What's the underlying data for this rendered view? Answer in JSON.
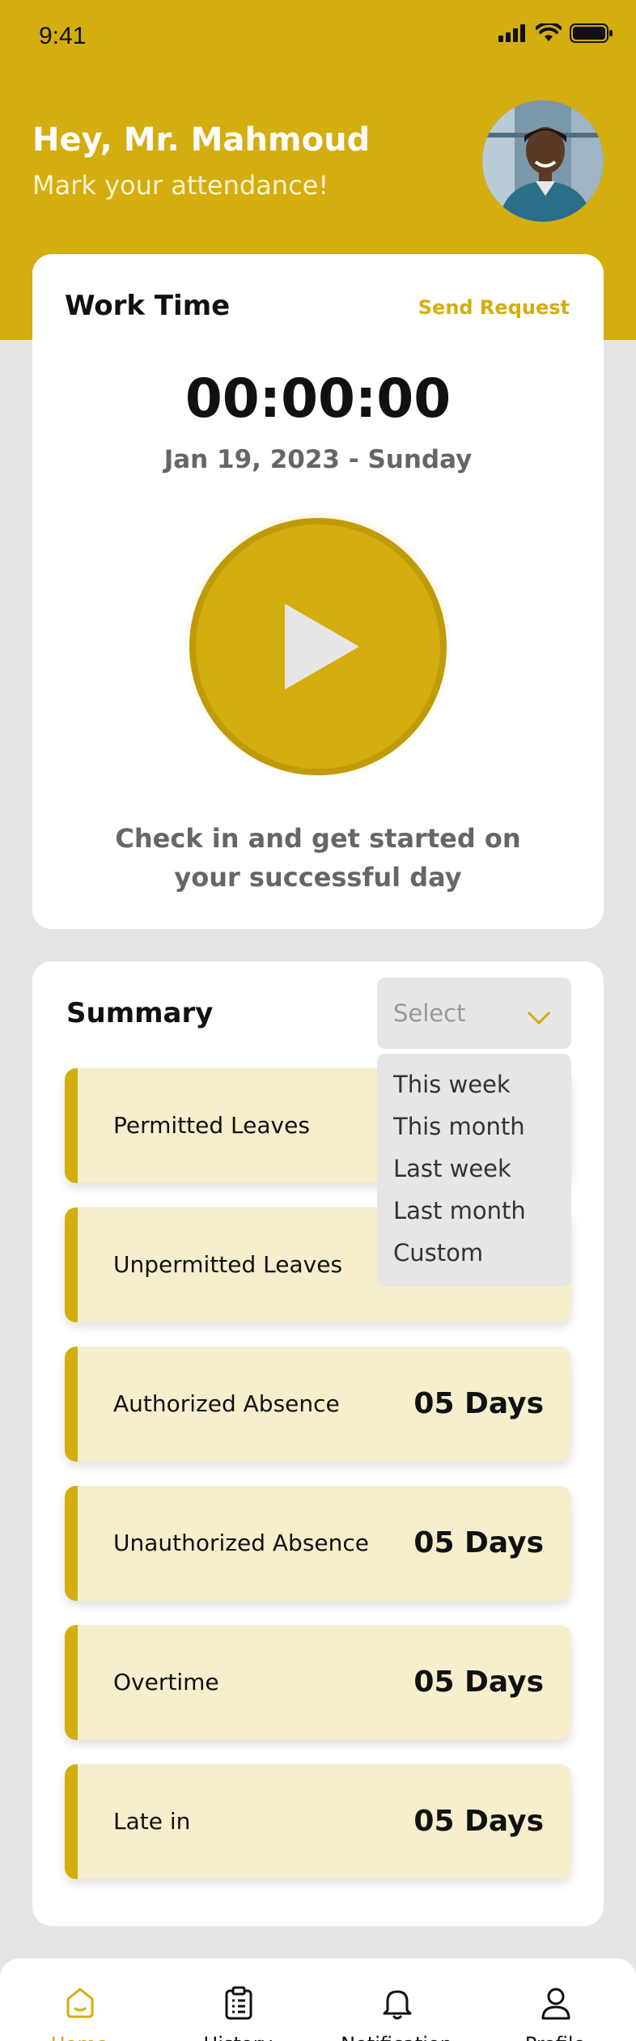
{
  "status_bar": {
    "time": "9:41"
  },
  "header": {
    "greeting": "Hey, Mr. Mahmoud",
    "subtitle": "Mark your attendance!"
  },
  "work_time": {
    "title": "Work Time",
    "send_request_label": "Send Request",
    "timer": "00:00:00",
    "date": "Jan 19, 2023 - Sunday",
    "play_icon": "play-icon",
    "checkin_message": "Check in and get started on your successful day"
  },
  "summary": {
    "title": "Summary",
    "select": {
      "placeholder": "Select",
      "options": [
        "This week",
        "This month",
        "Last week",
        "Last month",
        "Custom"
      ]
    },
    "rows": [
      {
        "label": "Permitted Leaves",
        "value": ""
      },
      {
        "label": "Unpermitted Leaves",
        "value": ""
      },
      {
        "label": "Authorized Absence",
        "value": "05 Days"
      },
      {
        "label": "Unauthorized Absence",
        "value": "05 Days"
      },
      {
        "label": "Overtime",
        "value": "05 Days"
      },
      {
        "label": "Late in",
        "value": "05 Days"
      }
    ]
  },
  "tab_bar": {
    "tabs": [
      {
        "label": "Home",
        "icon": "home-icon",
        "active": true
      },
      {
        "label": "History",
        "icon": "clipboard-icon",
        "active": false
      },
      {
        "label": "Notification",
        "icon": "bell-icon",
        "active": false
      },
      {
        "label": "Profile",
        "icon": "user-icon",
        "active": false
      }
    ]
  },
  "colors": {
    "accent": "#d4ad0e",
    "row_background": "#f7eecd",
    "page_background": "#e5e5e5"
  }
}
